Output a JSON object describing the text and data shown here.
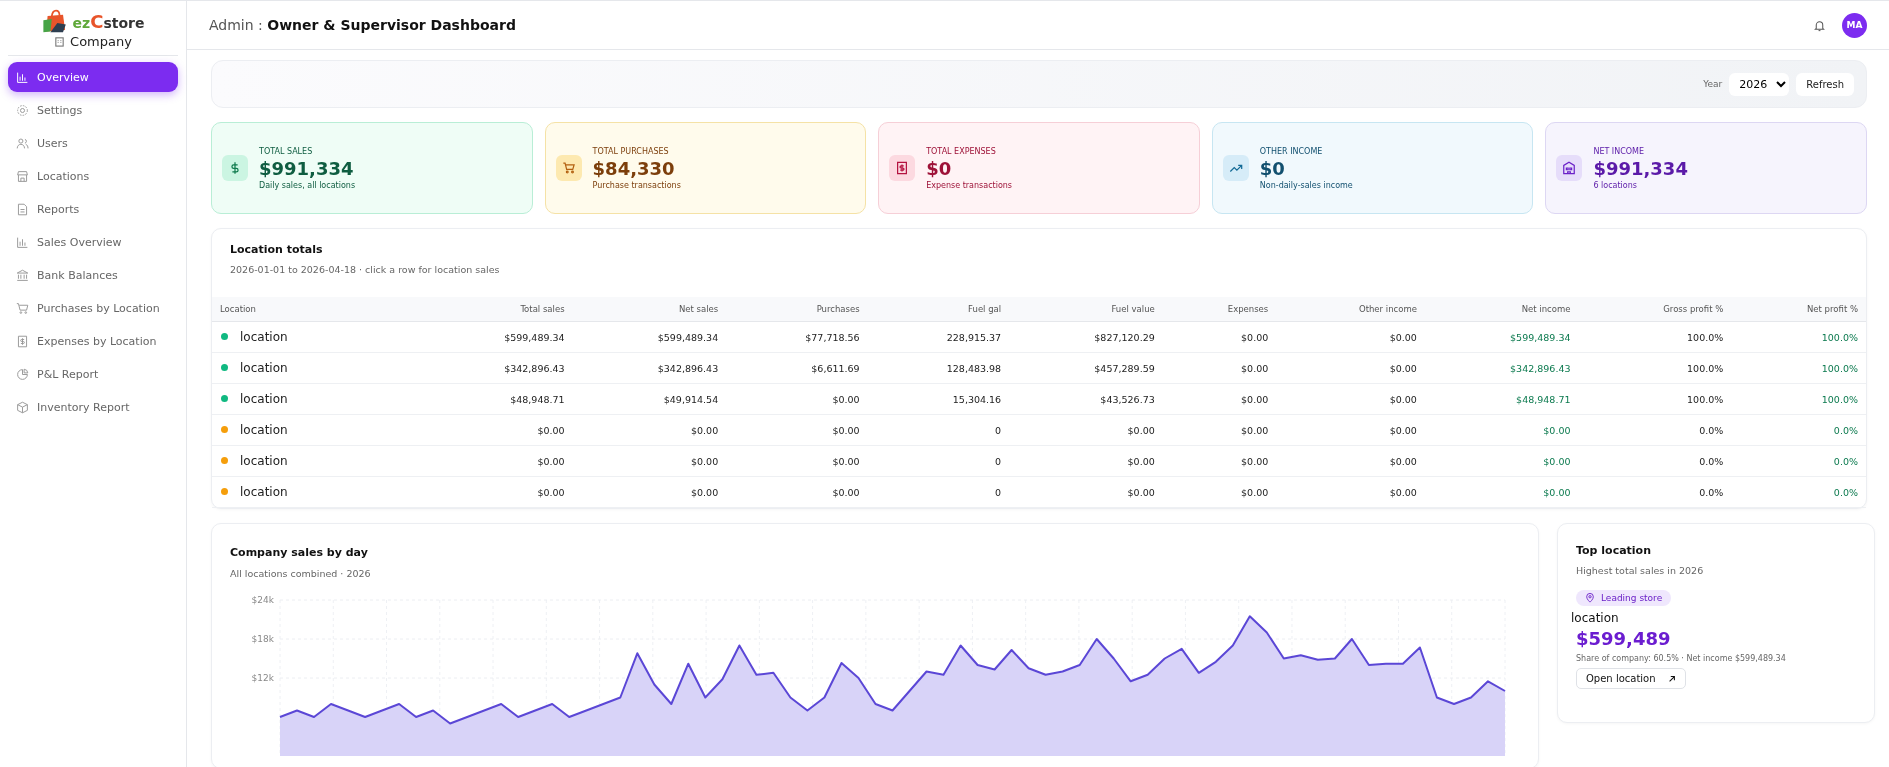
{
  "sidebar": {
    "logo": [
      "ez",
      "C",
      "store"
    ],
    "company": "Company",
    "items": [
      {
        "label": "Overview",
        "selected": true
      },
      {
        "label": "Settings",
        "selected": false
      },
      {
        "label": "Users",
        "selected": false
      },
      {
        "label": "Locations",
        "selected": false
      },
      {
        "label": "Reports",
        "selected": false
      },
      {
        "label": "Sales Overview",
        "selected": false
      },
      {
        "label": "Bank Balances",
        "selected": false
      },
      {
        "label": "Purchases by Location",
        "selected": false
      },
      {
        "label": "Expenses by Location",
        "selected": false
      },
      {
        "label": "P&L Report",
        "selected": false
      },
      {
        "label": "Inventory Report",
        "selected": false
      }
    ]
  },
  "header": {
    "title": "Admin : **Owner & Supervisor Dashboard**",
    "avatar": "MA"
  },
  "filter_bar": {
    "year_label": "Year",
    "year": "2026",
    "refresh": "Refresh"
  },
  "stat_cards": [
    {
      "kind": "sales",
      "title": "TOTAL SALES",
      "value": "$991,334",
      "note": "Daily sales, all locations"
    },
    {
      "kind": "purchases",
      "title": "TOTAL PURCHASES",
      "value": "$84,330",
      "note": "Purchase transactions"
    },
    {
      "kind": "expenses",
      "title": "TOTAL EXPENSES",
      "value": "$0",
      "note": "Expense transactions"
    },
    {
      "kind": "other",
      "title": "OTHER INCOME",
      "value": "$0",
      "note": "Non-daily-sales income"
    },
    {
      "kind": "net",
      "title": "NET INCOME",
      "value": "$991,334",
      "note": "6 locations"
    }
  ],
  "location_totals": {
    "title": "Location totals",
    "subtitle": "2026-01-01 to 2026-04-18 · click a row for location sales",
    "columns": [
      "Location",
      "Total sales",
      "Net sales",
      "Purchases",
      "Fuel gal",
      "Fuel value",
      "Expenses",
      "Other income",
      "Net income",
      "Gross profit %",
      "Net profit %"
    ],
    "rows": [
      {
        "color": "#10b981",
        "cells": [
          "location",
          "$599,489.34",
          "$599,489.34",
          "$77,718.56",
          "228,915.37",
          "$827,120.29",
          "$0.00",
          "$0.00",
          "$599,489.34",
          "100.0%",
          "100.0%"
        ]
      },
      {
        "color": "#10b981",
        "cells": [
          "location",
          "$342,896.43",
          "$342,896.43",
          "$6,611.69",
          "128,483.98",
          "$457,289.59",
          "$0.00",
          "$0.00",
          "$342,896.43",
          "100.0%",
          "100.0%"
        ]
      },
      {
        "color": "#10b981",
        "cells": [
          "location",
          "$48,948.71",
          "$49,914.54",
          "$0.00",
          "15,304.16",
          "$43,526.73",
          "$0.00",
          "$0.00",
          "$48,948.71",
          "100.0%",
          "100.0%"
        ]
      },
      {
        "color": "#f59e0b",
        "cells": [
          "location",
          "$0.00",
          "$0.00",
          "$0.00",
          "0",
          "$0.00",
          "$0.00",
          "$0.00",
          "$0.00",
          "0.0%",
          "0.0%"
        ]
      },
      {
        "color": "#f59e0b",
        "cells": [
          "location",
          "$0.00",
          "$0.00",
          "$0.00",
          "0",
          "$0.00",
          "$0.00",
          "$0.00",
          "$0.00",
          "0.0%",
          "0.0%"
        ]
      },
      {
        "color": "#f59e0b",
        "cells": [
          "location",
          "$0.00",
          "$0.00",
          "$0.00",
          "0",
          "$0.00",
          "$0.00",
          "$0.00",
          "$0.00",
          "0.0%",
          "0.0%"
        ]
      }
    ]
  },
  "sales_by_day": {
    "title": "Company sales by day",
    "subtitle": "All locations combined · 2026",
    "chart_data": {
      "type": "area",
      "grid": true,
      "ylim": [
        0,
        24000
      ],
      "yticks": [
        {
          "value": 12000,
          "label": "$12k"
        },
        {
          "value": 18000,
          "label": "$18k"
        },
        {
          "value": 24000,
          "label": "$24k"
        }
      ],
      "series": [
        {
          "color": "#5b47d6",
          "values": [
            6000,
            7000,
            6000,
            8000,
            7000,
            6000,
            7000,
            8000,
            6000,
            7000,
            5000,
            6000,
            7000,
            8000,
            6000,
            7000,
            8000,
            6000,
            7000,
            8000,
            9000,
            15800,
            11000,
            8000,
            14200,
            9000,
            11800,
            17000,
            12500,
            12800,
            9000,
            7000,
            9000,
            14300,
            12000,
            8000,
            7000,
            10000,
            13000,
            12500,
            17000,
            14000,
            13300,
            16300,
            13500,
            12500,
            13000,
            14000,
            18000,
            15000,
            11500,
            12500,
            15000,
            16500,
            12800,
            14500,
            17000,
            21500,
            19000,
            15000,
            15500,
            14800,
            15000,
            18000,
            14000,
            14200,
            14200,
            16700,
            9000,
            8000,
            9000,
            11500,
            10000
          ]
        }
      ]
    }
  },
  "top_location": {
    "title": "Top location",
    "subtitle": "Highest total sales in 2026",
    "badge": "Leading store",
    "name": "location",
    "amount": "$599,489",
    "share": "Share of company: 60.5% · Net income $599,489.34",
    "button": "Open location"
  }
}
